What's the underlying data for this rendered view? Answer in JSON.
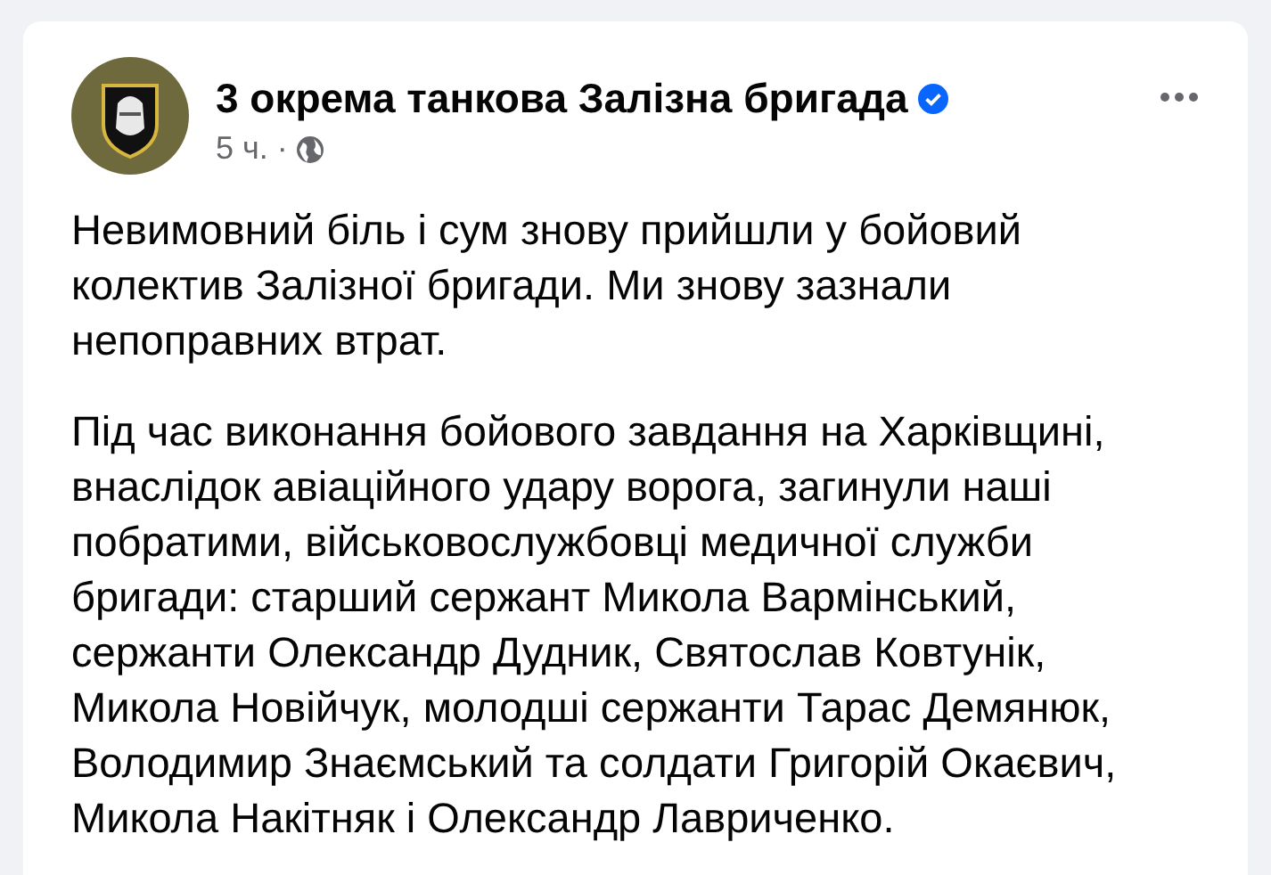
{
  "post": {
    "author": "3 окрема танкова Залізна бригада",
    "verified": true,
    "time": "5 ч.",
    "separator": "·",
    "public": true,
    "paragraphs": [
      "Невимовний біль і сум знову прийшли у бойовий\nколектив Залізної бригади. Ми знову зазнали\nнепоправних втрат.",
      "Під час виконання бойового завдання на Харківщині,\nвнаслідок авіаційного удару ворога, загинули наші\nпобратими, військовослужбовці медичної служби\nбригади: старший сержант Микола Вармінський,\nсержанти Олександр Дудник, Святослав Ковтунік,\nМикола Новійчук, молодші сержанти Тарас Демянюк,\nВолодимир Знаємський та солдати Григорій Окаєвич,\nМикола Накітняк і Олександр Лавриченко."
    ]
  }
}
